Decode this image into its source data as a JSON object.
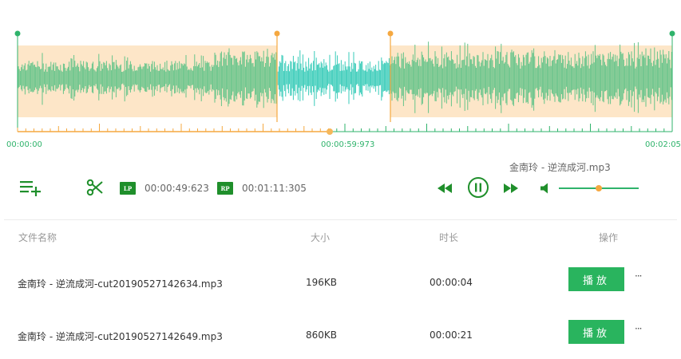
{
  "waveform": {
    "start_time": "00:00:00",
    "mid_time": "00:00:59:973",
    "end_time": "00:02:05",
    "colors": {
      "selected_bg": "#fde6c8",
      "wave_outside": "#64c48a",
      "wave_inside": "#37cbb8",
      "handle_green": "#2fb36b",
      "handle_orange": "#f5a840"
    }
  },
  "controls": {
    "add_list_icon": "playlist-add-icon",
    "cut_icon": "scissors-icon",
    "lp_label": "LP",
    "lp_time": "00:00:49:623",
    "rp_label": "RP",
    "rp_time": "00:01:11:305",
    "track_title": "金南玲 - 逆流成河.mp3",
    "volume_fraction": 0.5
  },
  "table": {
    "headers": {
      "name": "文件名称",
      "size": "大小",
      "duration": "时长",
      "actions": "操作"
    },
    "rows": [
      {
        "name": "金南玲 - 逆流成河-cut20190527142634.mp3",
        "size": "196KB",
        "duration": "00:00:04",
        "play_label": "播放",
        "more_label": "···"
      },
      {
        "name": "金南玲 - 逆流成河-cut20190527142649.mp3",
        "size": "860KB",
        "duration": "00:00:21",
        "play_label": "播放",
        "more_label": "···"
      }
    ]
  }
}
